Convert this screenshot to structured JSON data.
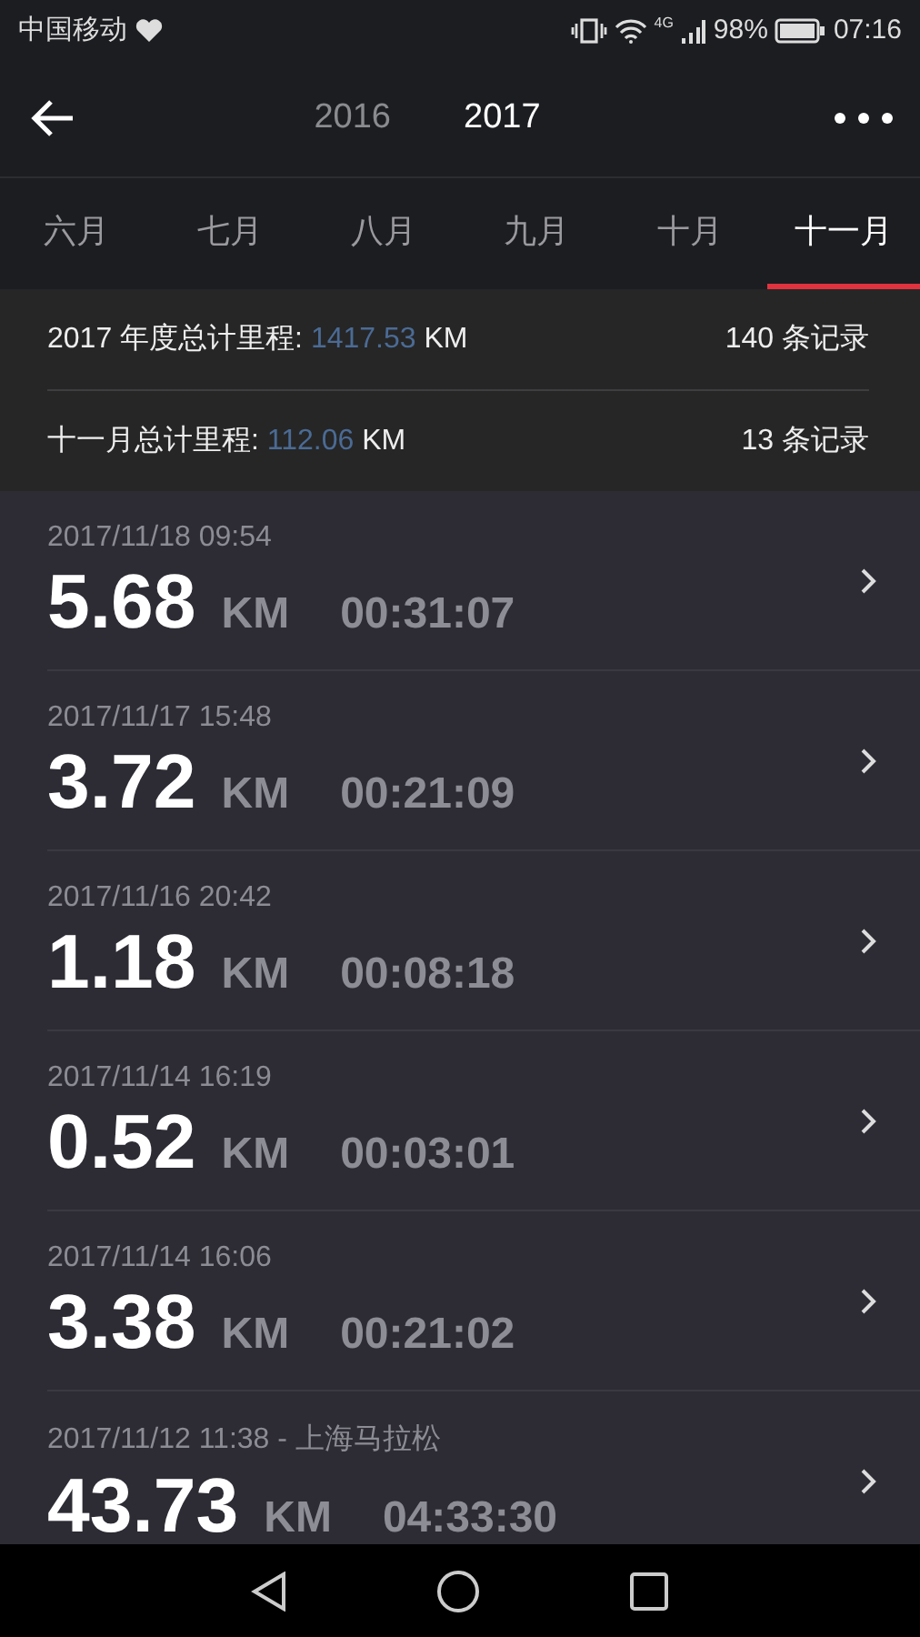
{
  "status_bar": {
    "carrier": "中国移动",
    "network": "4G",
    "battery": "98%",
    "time": "07:16"
  },
  "header": {
    "years": [
      {
        "label": "2016",
        "selected": false
      },
      {
        "label": "2017",
        "selected": true
      }
    ]
  },
  "month_tabs": [
    {
      "label": "六月",
      "selected": false
    },
    {
      "label": "七月",
      "selected": false
    },
    {
      "label": "八月",
      "selected": false
    },
    {
      "label": "九月",
      "selected": false
    },
    {
      "label": "十月",
      "selected": false
    },
    {
      "label": "十一月",
      "selected": true
    }
  ],
  "summary": [
    {
      "label": "2017 年度总计里程: ",
      "value": "1417.53",
      "unit": " KM",
      "count": "140 条记录"
    },
    {
      "label": "十一月总计里程: ",
      "value": "112.06",
      "unit": " KM",
      "count": "13 条记录"
    }
  ],
  "records": [
    {
      "date": "2017/11/18 09:54",
      "distance": "5.68",
      "unit": "KM",
      "duration": "00:31:07"
    },
    {
      "date": "2017/11/17 15:48",
      "distance": "3.72",
      "unit": "KM",
      "duration": "00:21:09"
    },
    {
      "date": "2017/11/16 20:42",
      "distance": "1.18",
      "unit": "KM",
      "duration": "00:08:18"
    },
    {
      "date": "2017/11/14 16:19",
      "distance": "0.52",
      "unit": "KM",
      "duration": "00:03:01"
    },
    {
      "date": "2017/11/14 16:06",
      "distance": "3.38",
      "unit": "KM",
      "duration": "00:21:02"
    },
    {
      "date": "2017/11/12 11:38 - 上海马拉松",
      "distance": "43.73",
      "unit": "KM",
      "duration": "04:33:30"
    }
  ]
}
